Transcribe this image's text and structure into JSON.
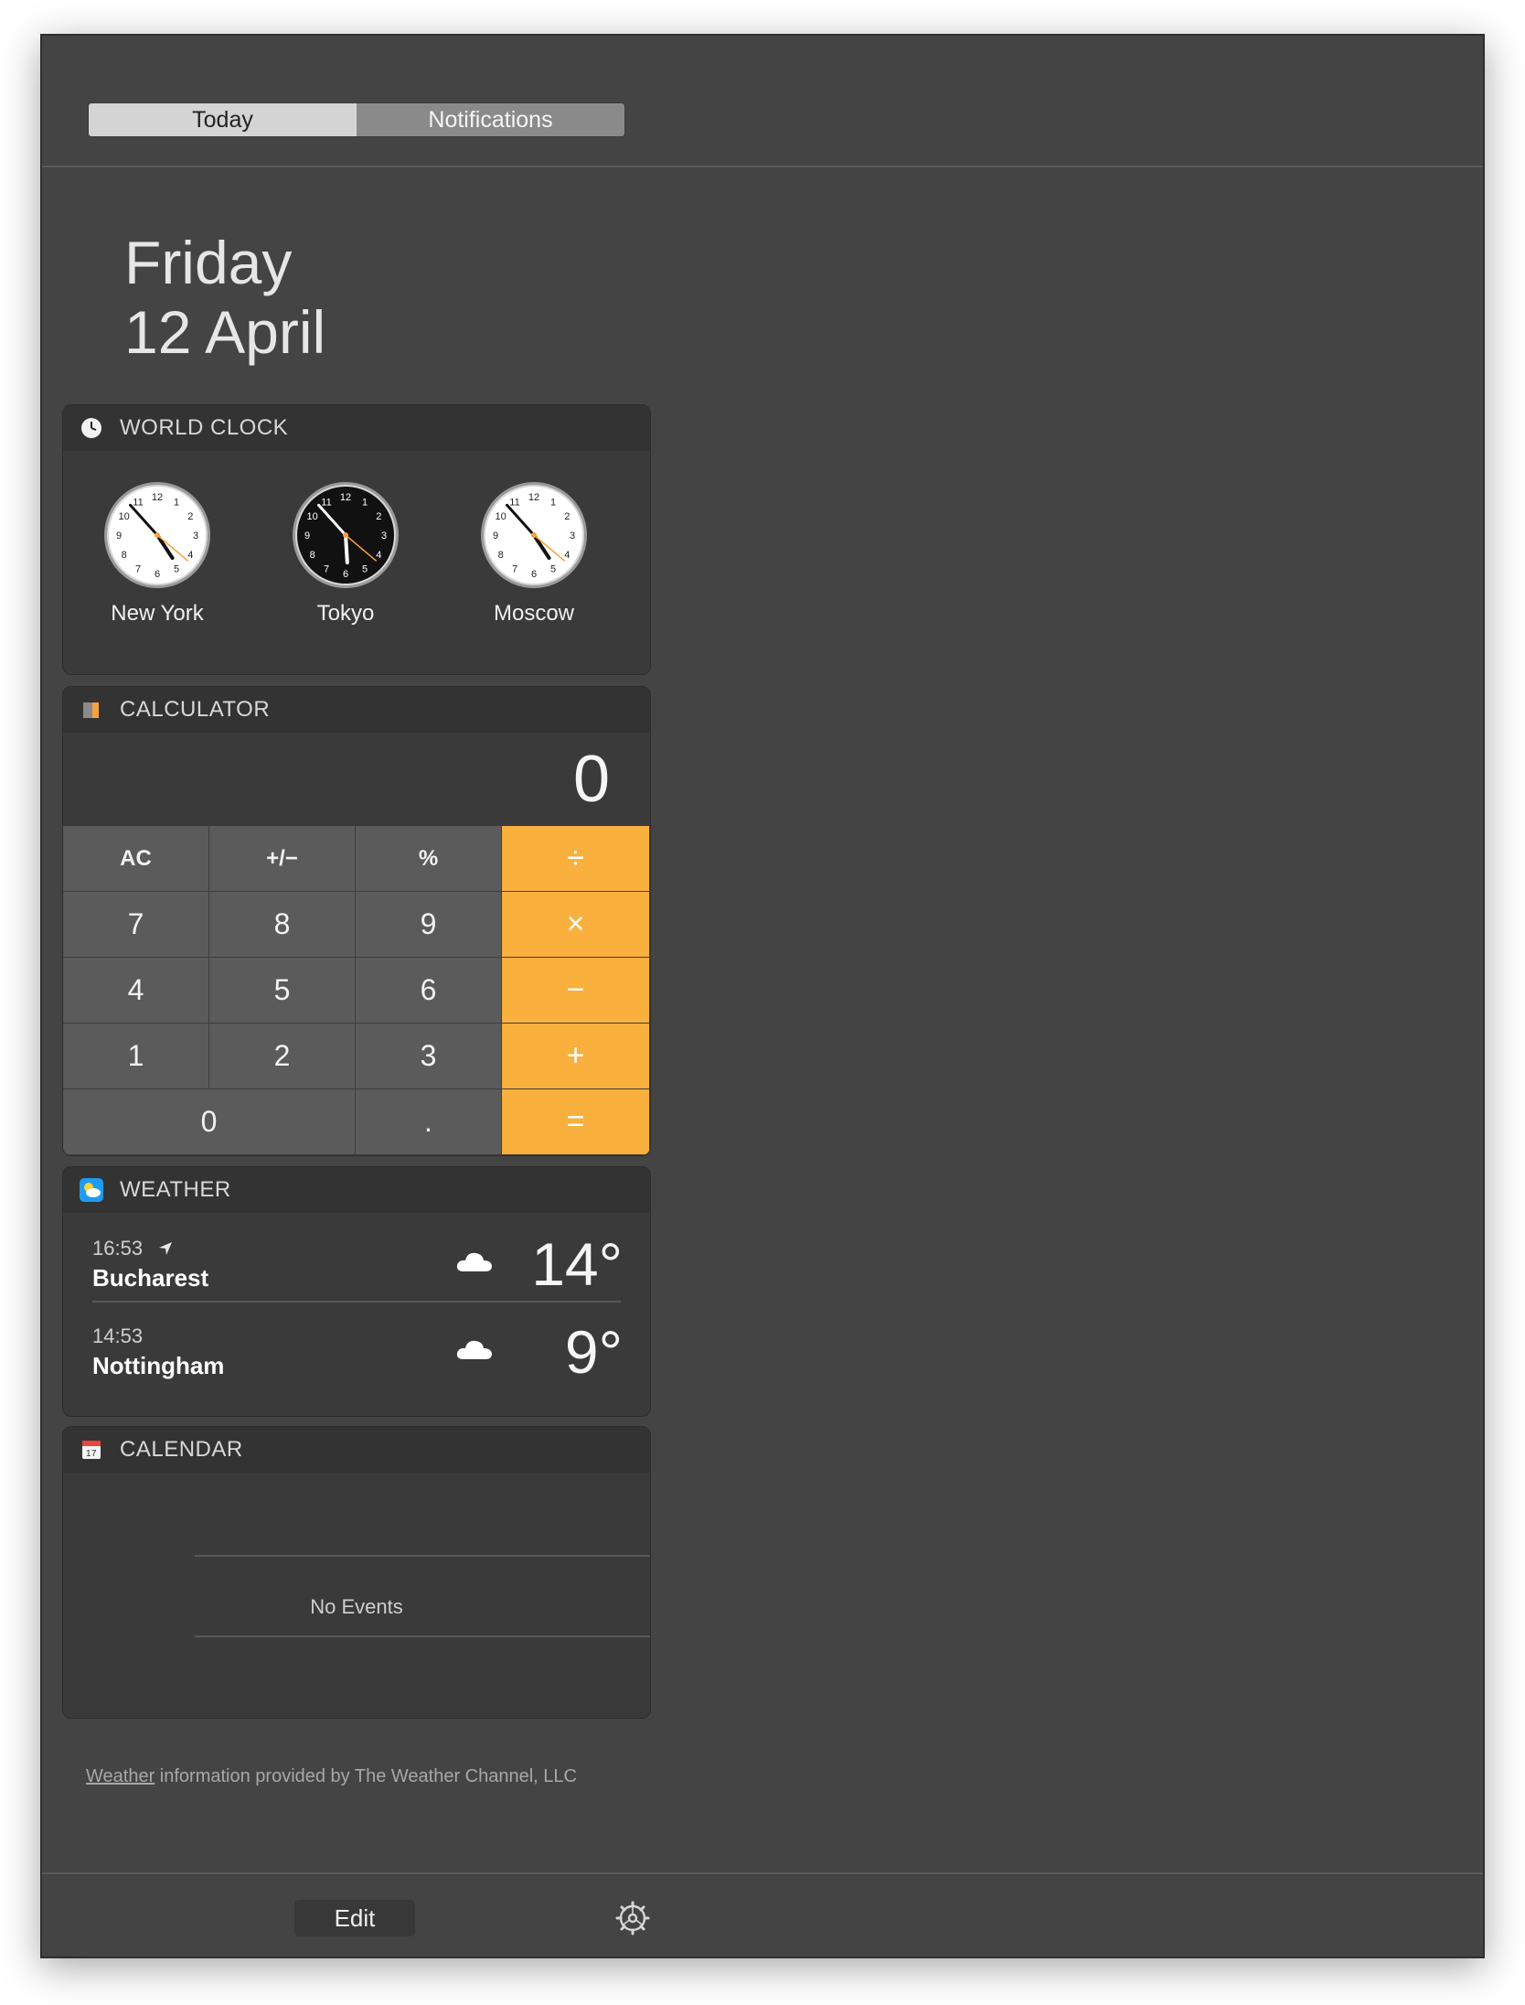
{
  "tabs": {
    "today": "Today",
    "notifications": "Notifications"
  },
  "date": {
    "weekday": "Friday",
    "day_month": "12 April"
  },
  "world_clock": {
    "title": "WORLD CLOCK",
    "numerals": [
      "12",
      "1",
      "2",
      "3",
      "4",
      "5",
      "6",
      "7",
      "8",
      "9",
      "10",
      "11"
    ],
    "clocks": [
      {
        "city": "New York",
        "time": "04:53",
        "face": "light"
      },
      {
        "city": "Tokyo",
        "time": "17:53",
        "face": "dark"
      },
      {
        "city": "Moscow",
        "time": "04:53",
        "face": "light"
      }
    ]
  },
  "calculator": {
    "title": "CALCULATOR",
    "display": "0",
    "keys": {
      "ac": "AC",
      "plusminus": "+/−",
      "percent": "%",
      "divide": "÷",
      "k7": "7",
      "k8": "8",
      "k9": "9",
      "multiply": "×",
      "k4": "4",
      "k5": "5",
      "k6": "6",
      "minus": "−",
      "k1": "1",
      "k2": "2",
      "k3": "3",
      "plus": "+",
      "k0": "0",
      "dot": ".",
      "equals": "="
    }
  },
  "weather": {
    "title": "WEATHER",
    "rows": [
      {
        "time": "16:53",
        "city": "Bucharest",
        "temp": "14°",
        "icon": "cloud-icon",
        "current_location": true
      },
      {
        "time": "14:53",
        "city": "Nottingham",
        "temp": "9°",
        "icon": "cloud-icon",
        "current_location": false
      }
    ]
  },
  "calendar": {
    "title": "CALENDAR",
    "no_events": "No Events"
  },
  "footer": {
    "link": "Weather",
    "text": " information provided by The Weather Channel, LLC"
  },
  "bottom": {
    "edit": "Edit",
    "settings_icon": "gear-icon"
  },
  "colors": {
    "panel": "#444444",
    "accent_orange": "#f9b03d",
    "key_gray": "#5b5b5b"
  }
}
